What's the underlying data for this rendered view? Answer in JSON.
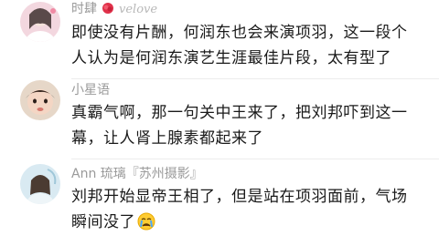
{
  "comments": [
    {
      "username": "时肆",
      "signature": "velove",
      "lines": [
        "即使没有片酬，何润东也会来演项羽，这一段个",
        "人认为是何润东演艺生涯最佳片段，太有型了"
      ]
    },
    {
      "username": "小星语",
      "lines": [
        "真霸气啊，那一句关中王来了，把刘邦吓到这一",
        "幕，让人肾上腺素都起来了"
      ]
    },
    {
      "username": "Ann 琉璃『苏州摄影』",
      "lines": [
        "刘邦开始显帝王相了，但是站在项羽面前，气场",
        "瞬间没了"
      ]
    }
  ],
  "icons": {
    "badge": "rose-flower-icon",
    "emoji": "crying-face-emoji-icon"
  }
}
